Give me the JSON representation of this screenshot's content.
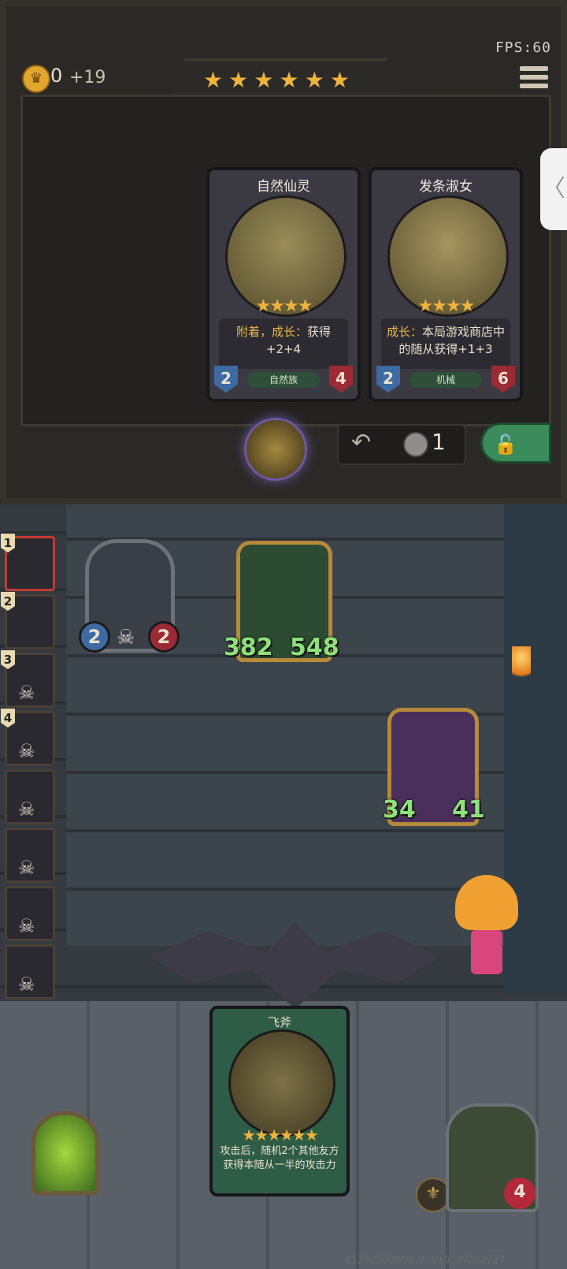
{
  "hud": {
    "gold": "0",
    "gold_income": "+19",
    "fps": "FPS:60",
    "tavern_stars": 6,
    "side_tab_glyph": "〈"
  },
  "shop": {
    "cards": [
      {
        "name": "自然仙灵",
        "stars": "★★★★",
        "desc_keyword": "附着，成长：",
        "desc_rest": "获得+2+4",
        "tribe": "自然族",
        "attack": "2",
        "health": "4"
      },
      {
        "name": "发条淑女",
        "stars": "★★★★",
        "desc_keyword": "成长：",
        "desc_rest": "本局游戏商店中的随从获得+1+3",
        "tribe": "机械",
        "attack": "2",
        "health": "6"
      }
    ],
    "reroll_cost": "1",
    "reroll_icon": "undo-arrow-icon",
    "lock_icon": "padlock-icon"
  },
  "turn_order": [
    {
      "num": "1",
      "active": true
    },
    {
      "num": "2",
      "active": false
    },
    {
      "num": "3",
      "active": false
    },
    {
      "num": "4",
      "active": false
    },
    {
      "num": "",
      "active": false
    },
    {
      "num": "",
      "active": false
    },
    {
      "num": "",
      "active": false
    },
    {
      "num": "",
      "active": false
    }
  ],
  "board": {
    "units": [
      {
        "name": "robot-unit",
        "attack": "2",
        "health": "2"
      },
      {
        "name": "treant-unit",
        "attack": "382",
        "health": "548"
      },
      {
        "name": "clown-unit",
        "attack": "34",
        "health": "41"
      }
    ]
  },
  "hand_card": {
    "name": "飞斧",
    "stars": "★★★★★★",
    "desc": "攻击后，随机2个其他友方获得本随从一半的攻击力"
  },
  "hero": {
    "health": "4"
  },
  "seed": "42292390069.3.019.09222217",
  "colors": {
    "gold": "#f0b43c",
    "stat_green": "#8ee07a",
    "lock_button": "#3a8c5a",
    "active_turn": "#c33b30"
  }
}
